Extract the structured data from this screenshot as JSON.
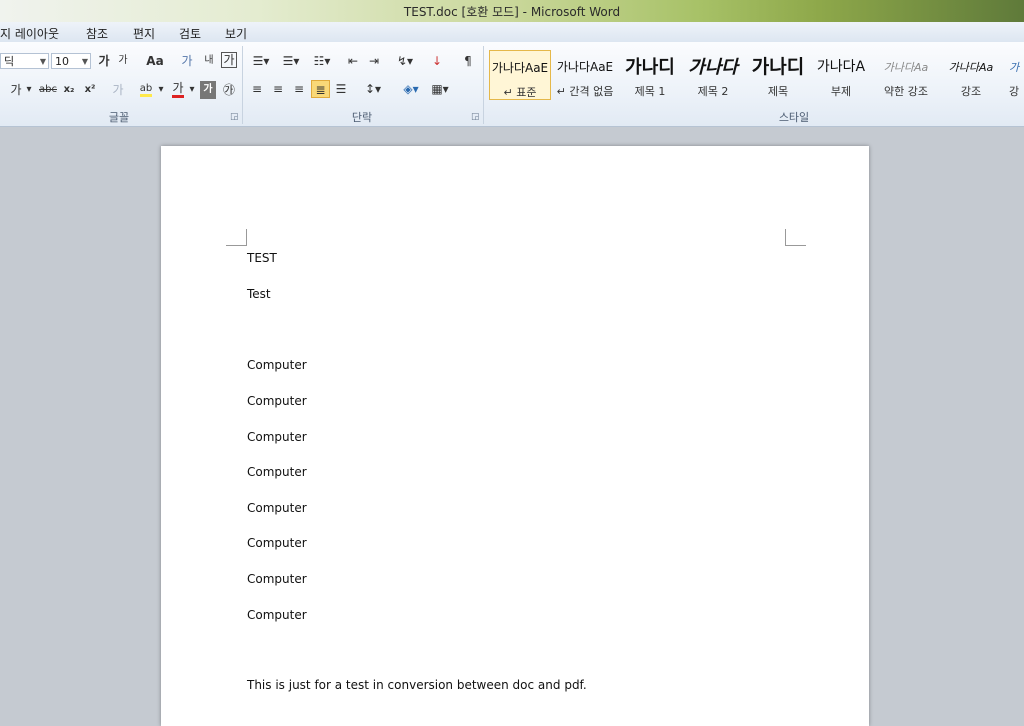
{
  "window": {
    "title": "TEST.doc [호환 모드] - Microsoft Word"
  },
  "menu": {
    "tabs": [
      "지 레이아웃",
      "참조",
      "편지",
      "검토",
      "보기"
    ]
  },
  "ribbon": {
    "font_group": {
      "label": "글꼴",
      "font_name": "딕",
      "font_size": "10",
      "grow": "가",
      "shrink": "가",
      "change_case": "Aa",
      "clear_format": "가",
      "phonetic": "내",
      "border_char": "가",
      "bold_char": "가",
      "strike": "abc",
      "subscript": "x₂",
      "superscript": "x²",
      "text_effect": "가",
      "highlight": "ab",
      "font_color": "가",
      "char_shading": "가",
      "enclose": "㉮"
    },
    "paragraph_group": {
      "label": "단락"
    },
    "styles_group": {
      "label": "스타일",
      "tiles": [
        {
          "preview": "가나다AaE",
          "name": "↵ 표준"
        },
        {
          "preview": "가나다AaE",
          "name": "↵ 간격 없음"
        },
        {
          "preview": "가나디",
          "name": "제목 1"
        },
        {
          "preview": "가나다",
          "name": "제목 2"
        },
        {
          "preview": "가나디",
          "name": "제목"
        },
        {
          "preview": "가나다A",
          "name": "부제"
        },
        {
          "preview": "가나다Aa",
          "name": "약한 강조"
        },
        {
          "preview": "가나다Aa",
          "name": "강조"
        },
        {
          "preview": "가",
          "name": "강"
        }
      ]
    }
  },
  "document": {
    "paragraphs": [
      "TEST",
      "Test",
      "Computer",
      "Computer",
      "Computer",
      "Computer",
      "Computer",
      "Computer",
      "Computer",
      "Computer",
      "This is just for a test in conversion between doc and pdf."
    ]
  },
  "colors": {
    "font_color_bar": "#dd2222",
    "highlight_bar": "#ffe94a",
    "selected_style": "#fff6d6"
  }
}
